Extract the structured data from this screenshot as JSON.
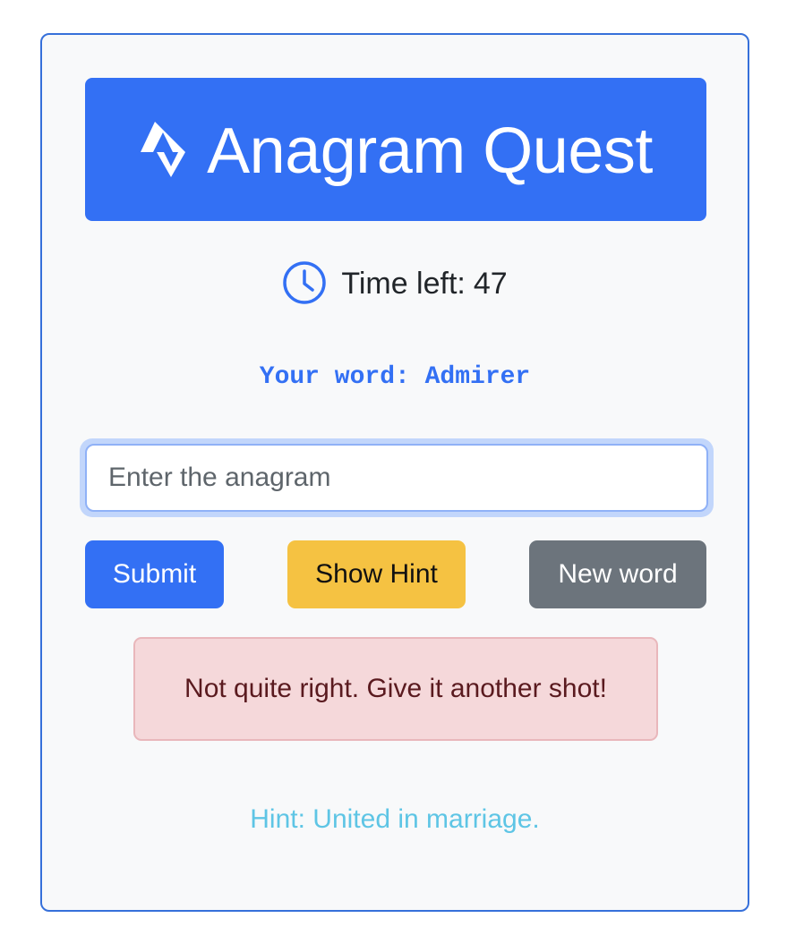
{
  "app": {
    "title": "Anagram Quest",
    "title_icon": "zigzag-arrows-icon"
  },
  "timer": {
    "icon": "clock-icon",
    "label": "Time left:",
    "value": "47"
  },
  "word": {
    "label": "Your word:",
    "value": "Admirer"
  },
  "answer_input": {
    "value": "",
    "placeholder": "Enter the anagram"
  },
  "buttons": {
    "submit_label": "Submit",
    "hint_label": "Show Hint",
    "new_word_label": "New word"
  },
  "feedback": {
    "message": "Not quite right. Give it another shot!"
  },
  "hint": {
    "text": "Hint: United in marriage."
  },
  "colors": {
    "primary": "#3370f4",
    "warning": "#f5c242",
    "secondary": "#6c747c",
    "danger_bg": "#f5d8da",
    "danger_text": "#5a1a1f",
    "info_text": "#5ec5e5"
  }
}
